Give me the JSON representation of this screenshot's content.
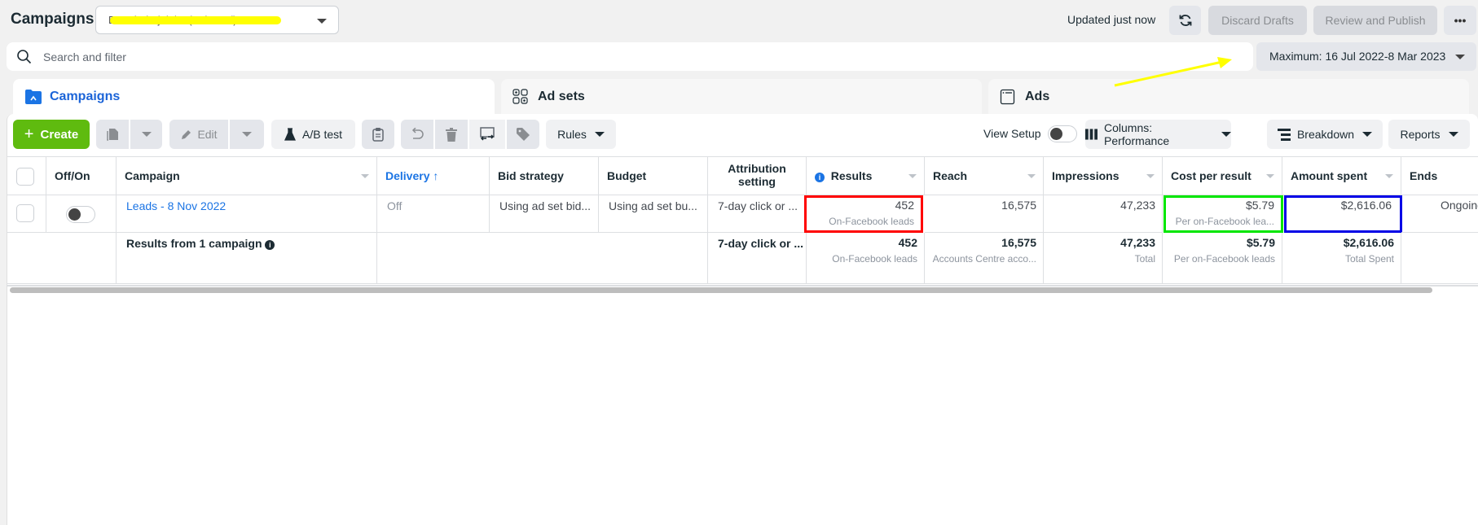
{
  "header": {
    "title": "Campaigns",
    "account_selector_value": "BM Shahajalal 2 (redacted)",
    "updated_text": "Updated just now",
    "discard_label": "Discard Drafts",
    "publish_label": "Review and Publish",
    "more_label": "•••"
  },
  "search": {
    "placeholder": "Search and filter",
    "value": ""
  },
  "date_range": {
    "label": "Maximum: 16 Jul 2022-8 Mar 2023"
  },
  "tabs": [
    {
      "label": "Campaigns",
      "icon": "folder-icon",
      "active": true
    },
    {
      "label": "Ad sets",
      "icon": "grid-icon",
      "active": false
    },
    {
      "label": "Ads",
      "icon": "ad-window-icon",
      "active": false
    }
  ],
  "toolbar": {
    "create_label": "Create",
    "edit_label": "Edit",
    "ab_test_label": "A/B test",
    "rules_label": "Rules",
    "view_setup_label": "View Setup",
    "view_setup_on": false,
    "columns_label": "Columns: Performance",
    "breakdown_label": "Breakdown",
    "reports_label": "Reports"
  },
  "table": {
    "columns": [
      "Off/On",
      "Campaign",
      "Delivery",
      "Bid strategy",
      "Budget",
      "Attribution setting",
      "Results",
      "Reach",
      "Impressions",
      "Cost per result",
      "Amount spent",
      "Ends"
    ],
    "sort_indicator": "↑",
    "rows": [
      {
        "on": false,
        "campaign": "Leads - 8 Nov 2022",
        "delivery": "Off",
        "bid_strategy": "Using ad set bid...",
        "budget": "Using ad set bu...",
        "attribution": "7-day click or ...",
        "results": "452",
        "results_sub": "On-Facebook leads",
        "reach": "16,575",
        "impressions": "47,233",
        "cost_per_result": "$5.79",
        "cost_per_result_sub": "Per on-Facebook lea...",
        "amount_spent": "$2,616.06",
        "ends": "Ongoing"
      }
    ],
    "totals": {
      "label": "Results from 1 campaign",
      "attribution": "7-day click or ...",
      "results": "452",
      "results_sub": "On-Facebook leads",
      "reach": "16,575",
      "reach_sub": "Accounts Centre acco...",
      "impressions": "47,233",
      "impressions_sub": "Total",
      "cost_per_result": "$5.79",
      "cost_per_result_sub": "Per on-Facebook leads",
      "amount_spent": "$2,616.06",
      "amount_spent_sub": "Total Spent"
    }
  },
  "annotations": {
    "results_box_color": "#ff0000",
    "cost_box_color": "#00e600",
    "spent_box_color": "#0000e6",
    "arrow_color": "#ffff00"
  }
}
